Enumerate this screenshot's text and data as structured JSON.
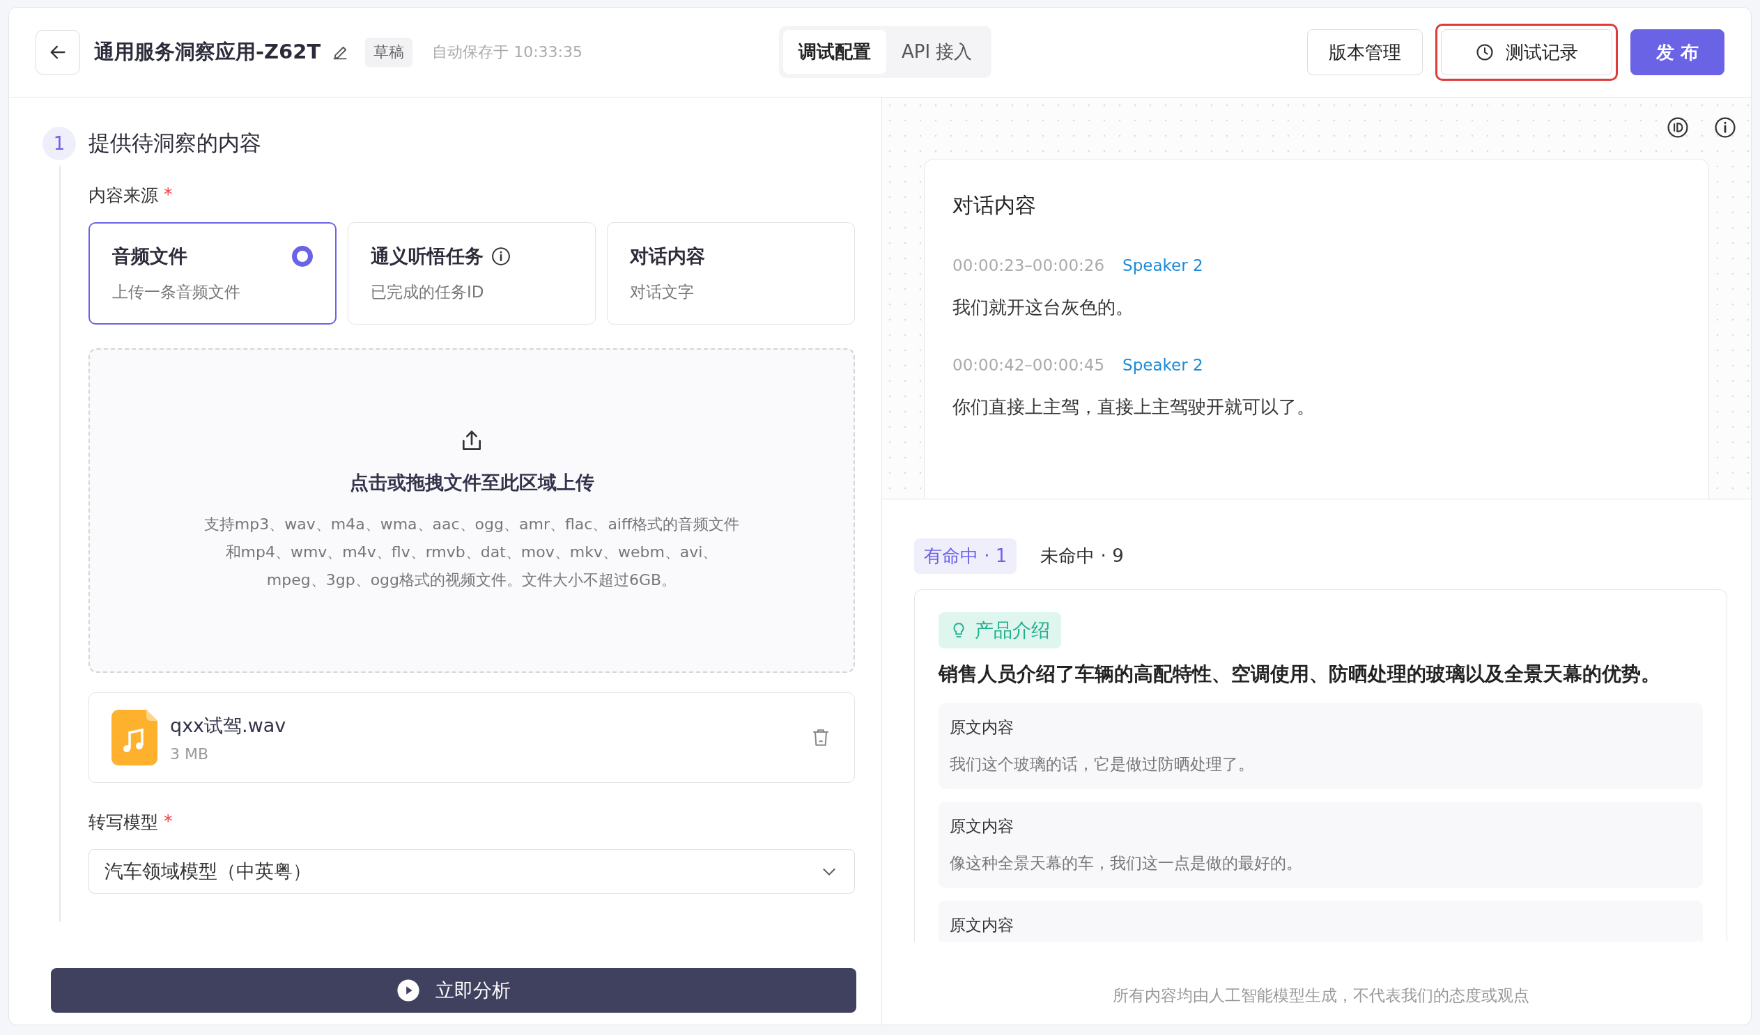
{
  "header": {
    "title": "通用服务洞察应用-Z62T",
    "status_badge": "草稿",
    "autosave": "自动保存于 10:33:35",
    "mode_tabs": [
      {
        "label": "调试配置",
        "selected": true
      },
      {
        "label": "API 接入",
        "selected": false
      }
    ],
    "buttons": [
      {
        "kind": "plain",
        "label": "版本管理"
      },
      {
        "kind": "history",
        "label": "测试记录",
        "highlighted": true
      },
      {
        "kind": "primary",
        "label": "发 布"
      }
    ]
  },
  "left": {
    "step_number": "1",
    "step_title": "提供待洞察的内容",
    "source_label": "内容来源",
    "source_required_mark": "*",
    "source_options": [
      {
        "title": "音频文件",
        "subtitle": "上传一条音频文件",
        "selected": true,
        "info": false
      },
      {
        "title": "通义听悟任务",
        "subtitle": "已完成的任务ID",
        "selected": false,
        "info": true
      },
      {
        "title": "对话内容",
        "subtitle": "对话文字",
        "selected": false,
        "info": false
      }
    ],
    "upload": {
      "title": "点击或拖拽文件至此区域上传",
      "description": "支持mp3、wav、m4a、wma、aac、ogg、amr、flac、aiff格式的音频文件和mp4、wmv、m4v、flv、rmvb、dat、mov、mkv、webm、avi、mpeg、3gp、ogg格式的视频文件。文件大小不超过6GB。"
    },
    "file": {
      "name": "qxx试驾.wav",
      "size": "3 MB"
    },
    "model_label": "转写模型",
    "model_required_mark": "*",
    "model_value": "汽车领域模型（中英粤）",
    "analyze_button": "立即分析"
  },
  "right": {
    "transcript_title": "对话内容",
    "transcript": [
      {
        "time": "00:00:23–00:00:26",
        "speaker": "Speaker 2",
        "text": "我们就开这台灰色的。"
      },
      {
        "time": "00:00:42–00:00:45",
        "speaker": "Speaker 2",
        "text": "你们直接上主驾，直接上主驾驶开就可以了。"
      }
    ],
    "result_tabs": [
      {
        "label": "有命中 · 1",
        "selected": true
      },
      {
        "label": "未命中 · 9",
        "selected": false
      }
    ],
    "insight": {
      "tag": "产品介绍",
      "summary": "销售人员介绍了车辆的高配特性、空调使用、防晒处理的玻璃以及全景天幕的优势。",
      "quotes": [
        {
          "label": "原文内容",
          "text": "我们这个玻璃的话，它是做过防晒处理了。"
        },
        {
          "label": "原文内容",
          "text": "像这种全景天幕的车，我们这一点是做的最好的。"
        },
        {
          "label": "原文内容"
        }
      ]
    },
    "disclaimer": "所有内容均由人工智能模型生成，不代表我们的态度或观点"
  }
}
